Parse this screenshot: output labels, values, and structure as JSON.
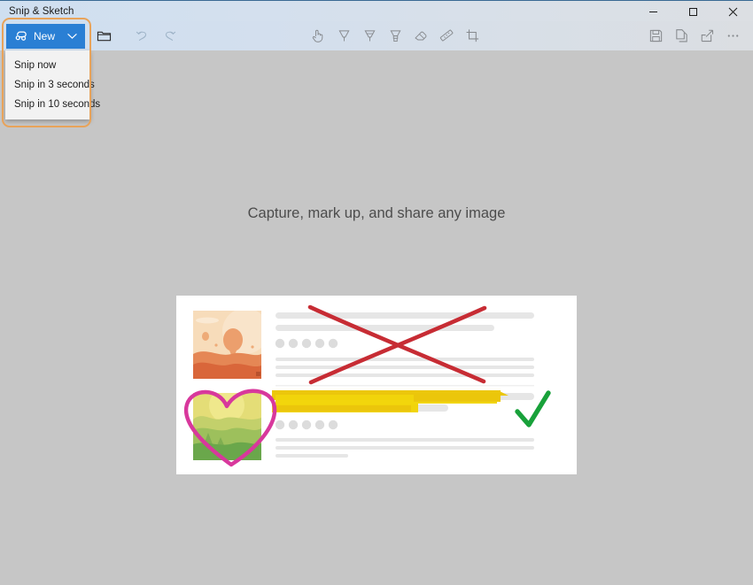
{
  "window": {
    "title": "Snip & Sketch",
    "controls": [
      {
        "name": "minimize",
        "glyph": "minimize-icon"
      },
      {
        "name": "maximize",
        "glyph": "maximize-icon"
      },
      {
        "name": "close",
        "glyph": "close-icon"
      }
    ]
  },
  "toolbar": {
    "new_button": {
      "label": "New",
      "icon": "new-snip-icon",
      "chevron": "chevron-down-icon",
      "background": "#2a7fd4",
      "text_color": "#ffffff"
    },
    "open_button": {
      "icon": "open-file-icon"
    },
    "history": [
      {
        "name": "undo",
        "icon": "undo-arrow-icon",
        "enabled": false
      },
      {
        "name": "redo",
        "icon": "redo-arrow-icon",
        "enabled": false
      }
    ],
    "annotation_tools": [
      {
        "name": "touch-writing",
        "icon": "touch-writing-icon"
      },
      {
        "name": "ballpoint-pen",
        "icon": "ballpoint-pen-icon"
      },
      {
        "name": "pencil",
        "icon": "pencil-tool-icon"
      },
      {
        "name": "highlighter",
        "icon": "highlighter-icon"
      },
      {
        "name": "eraser",
        "icon": "eraser-icon"
      },
      {
        "name": "ruler",
        "icon": "ruler-icon"
      },
      {
        "name": "crop",
        "icon": "crop-icon"
      }
    ],
    "actions": [
      {
        "name": "save",
        "icon": "save-disk-icon"
      },
      {
        "name": "copy",
        "icon": "copy-pages-icon"
      },
      {
        "name": "share",
        "icon": "share-arrow-icon"
      },
      {
        "name": "more",
        "icon": "more-ellipsis-icon"
      }
    ]
  },
  "dropdown": {
    "visible": true,
    "items": [
      {
        "label": "Snip now"
      },
      {
        "label": "Snip in 3 seconds"
      },
      {
        "label": "Snip in 10 seconds"
      }
    ]
  },
  "annotation_highlight": {
    "shape": "rounded-rectangle",
    "color": "#e8a35a",
    "targets": "new-button-and-dropdown"
  },
  "hero": {
    "title": "Capture, mark up, and share any image",
    "title_color": "#4c4c4c",
    "card_background": "#ffffff",
    "canvas_background": "#c6c6c6",
    "illustration": {
      "thumbnails": [
        {
          "name": "balloon-desert-thumbnail",
          "palette": [
            "#f6d8b4",
            "#eeab78",
            "#e07f4f",
            "#d96a3c"
          ]
        },
        {
          "name": "green-landscape-thumbnail",
          "palette": [
            "#eadc72",
            "#b9cf63",
            "#93bb5a",
            "#6aa74b"
          ]
        }
      ],
      "markup": [
        {
          "name": "red-cross-out",
          "color": "#c72c34",
          "shape": "x-stroke"
        },
        {
          "name": "yellow-highlight",
          "color": "#ecc500",
          "shape": "highlight-bars"
        },
        {
          "name": "green-checkmark",
          "color": "#18a13a",
          "shape": "check"
        },
        {
          "name": "pink-heart",
          "color": "#d8389c",
          "shape": "heart-outline"
        }
      ],
      "placeholder_bar_color": "#e4e4e4",
      "placeholder_dot_color": "#d9d9d9"
    }
  }
}
